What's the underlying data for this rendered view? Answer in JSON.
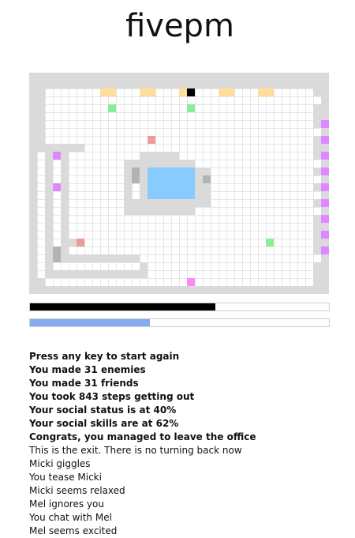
{
  "app": {
    "title": "fivepm"
  },
  "colors": {
    "background": "#ffffff",
    "grid_line": "#e6e6e6",
    "wall": "#dadada",
    "desk": "#ffde99",
    "exit": "#000000",
    "friend": "#88ee99",
    "enemy": "#ef9999",
    "chair": "#b3b3b3",
    "water": "#88ccff",
    "coworker": "#dd88ff",
    "player": "#ff88ff",
    "progress": "#000000",
    "social": "#88aaee"
  },
  "game": {
    "legend": [
      {
        "key": "wall",
        "icon": "wall-tile"
      },
      {
        "key": "desk",
        "icon": "desk-tile"
      },
      {
        "key": "exit",
        "icon": "exit-door-tile"
      },
      {
        "key": "friend",
        "icon": "friend-npc"
      },
      {
        "key": "enemy",
        "icon": "enemy-npc"
      },
      {
        "key": "chair",
        "icon": "chair-tile"
      },
      {
        "key": "water",
        "icon": "water-cooler-pool"
      },
      {
        "key": "coworker",
        "icon": "coworker-npc"
      },
      {
        "key": "player",
        "icon": "player-avatar"
      }
    ],
    "map": [
      "######################################",
      "######################################",
      "##.......DD...DD...DE...DD...DD.....##",
      "##...................................##",
      "##........F.........F...............##",
      "##..................................###",
      "##..................................#C#",
      "##...................................##",
      "##.............N....................#C#",
      "#######.............................##",
      "#.#C#.........#####.................#C#",
      "#.#.#.......#########................##",
      "#.#.#.......#H#WWWWWW##.............#C#",
      "#.#.#.......#H#WWWWWW#H..............##",
      "#.#C#.......#.#WWWWWW##.............#C#",
      "#.#.#.......#.#WWWWWW##..............##",
      "#.#.#.......###########.............#C#",
      "#.#.#.......#########................##",
      "#.#.#...............................#C#",
      "#.#.#...............................##.",
      "#.#.#...............................#C#",
      "#.#.##N.......................F.....##.",
      "#.#H#...............................#C#",
      "#.#H##########.......................##",
      "#.#...........#.....................##.",
      "#.#############.....................###",
      "##..................P...............###",
      "######################################"
    ],
    "progress_fraction": 0.62,
    "social_fraction": 0.4
  },
  "log": [
    {
      "text": "Press any key to start again",
      "bold": true
    },
    {
      "text": "You made 31 enemies",
      "bold": true
    },
    {
      "text": "You made 31 friends",
      "bold": true
    },
    {
      "text": "You took 843 steps getting out",
      "bold": true
    },
    {
      "text": "Your social status is at 40%",
      "bold": true
    },
    {
      "text": "Your social skills are at 62%",
      "bold": true
    },
    {
      "text": "Congrats, you managed to leave the office",
      "bold": true
    },
    {
      "text": "This is the exit. There is no turning back now",
      "bold": false
    },
    {
      "text": "Micki giggles",
      "bold": false
    },
    {
      "text": "You tease Micki",
      "bold": false
    },
    {
      "text": "Micki seems relaxed",
      "bold": false
    },
    {
      "text": "Mel ignores you",
      "bold": false
    },
    {
      "text": "You chat with Mel",
      "bold": false
    },
    {
      "text": "Mel seems excited",
      "bold": false
    }
  ]
}
